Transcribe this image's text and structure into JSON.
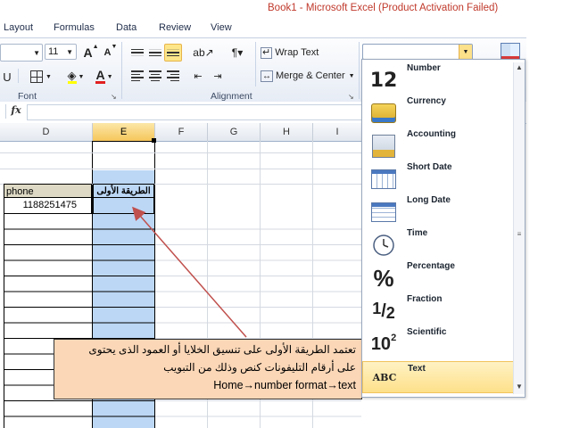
{
  "app": {
    "window_title": "Book1 -  Microsoft Excel (Product Activation Failed)",
    "tabs": [
      "Layout",
      "Formulas",
      "Data",
      "Review",
      "View"
    ]
  },
  "ribbon": {
    "font_size": "11",
    "grow_font_label": "A",
    "shrink_font_label": "A",
    "font_color_label": "A",
    "font_group_label": "Font",
    "alignment_group_label": "Alignment",
    "wrap_text_label": "Wrap Text",
    "merge_center_label": "Merge & Center",
    "number_format_value": ""
  },
  "formula_bar": {
    "fx_label": "fx",
    "value": ""
  },
  "grid": {
    "columns": [
      "D",
      "E",
      "F",
      "G",
      "H",
      "I"
    ],
    "selected_column": "E",
    "cells": {
      "D_phone_header": "phone",
      "D_value": "1188251475",
      "E_header": "الطريقة الأولى"
    }
  },
  "number_formats": [
    {
      "label": "Number",
      "icon": "number-12-icon"
    },
    {
      "label": "Currency",
      "icon": "currency-icon"
    },
    {
      "label": "Accounting",
      "icon": "accounting-icon"
    },
    {
      "label": "Short Date",
      "icon": "short-date-icon"
    },
    {
      "label": "Long Date",
      "icon": "long-date-icon"
    },
    {
      "label": "Time",
      "icon": "clock-icon"
    },
    {
      "label": "Percentage",
      "icon": "percent-icon"
    },
    {
      "label": "Fraction",
      "icon": "fraction-icon"
    },
    {
      "label": "Scientific",
      "icon": "scientific-icon"
    },
    {
      "label": "Text",
      "icon": "abc-icon"
    }
  ],
  "number_format_icon_text": {
    "number": "12",
    "percentage": "%",
    "fraction_num": "1",
    "fraction_den": "2",
    "scientific_base": "10",
    "scientific_exp": "2",
    "text": "ABC"
  },
  "callout": {
    "line1": "تعتمد الطريقة الأولى على تنسيق الخلايا أو العمود الذى يحتوى",
    "line2": "على أرقام التليفونات كنص وذلك من التبويب",
    "line3": "Home→number format→text"
  },
  "colors": {
    "title_red": "#c0392b",
    "selection_blue": "#bcd7f5",
    "callout_fill": "#fbd7b7",
    "arrow": "#c0504d",
    "highlight": "#fde08a"
  }
}
